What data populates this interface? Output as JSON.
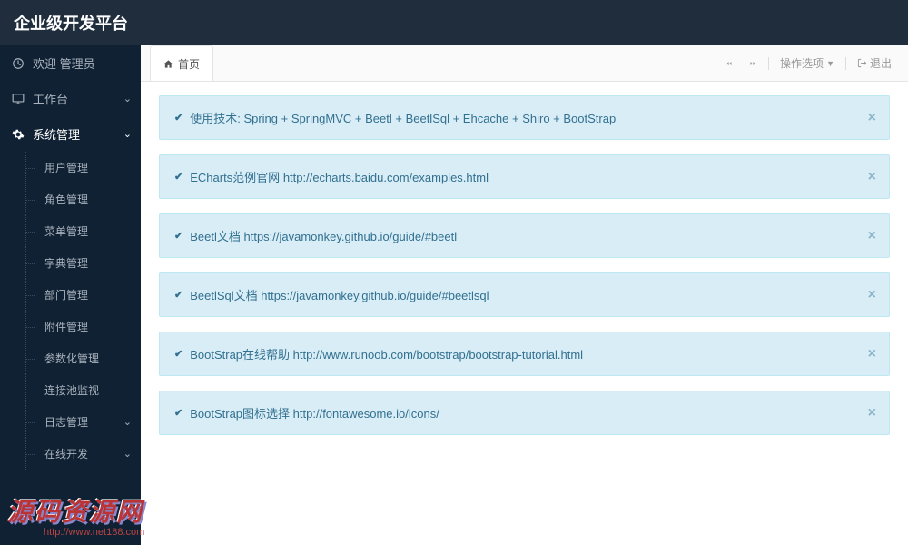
{
  "header": {
    "title": "企业级开发平台"
  },
  "sidebar": {
    "welcome_prefix": "欢迎",
    "welcome_user": "管理员",
    "workbench": "工作台",
    "system_mgmt": "系统管理",
    "sub": {
      "user_mgmt": "用户管理",
      "role_mgmt": "角色管理",
      "menu_mgmt": "菜单管理",
      "dict_mgmt": "字典管理",
      "dept_mgmt": "部门管理",
      "attach_mgmt": "附件管理",
      "param_mgmt": "参数化管理",
      "conn_monitor": "连接池监视",
      "log_mgmt": "日志管理",
      "online_dev": "在线开发"
    }
  },
  "tabs": {
    "home": "首页"
  },
  "tabbar": {
    "actions": "操作选项",
    "exit": "退出"
  },
  "alerts": [
    {
      "prefix": "使用技术:",
      "text": "Spring + SpringMVC + Beetl + BeetlSql + Ehcache + Shiro + BootStrap",
      "link": ""
    },
    {
      "prefix": "ECharts范例官网",
      "text": "",
      "link": "http://echarts.baidu.com/examples.html"
    },
    {
      "prefix": "Beetl文档",
      "text": "",
      "link": "https://javamonkey.github.io/guide/#beetl"
    },
    {
      "prefix": "BeetlSql文档",
      "text": "",
      "link": "https://javamonkey.github.io/guide/#beetlsql"
    },
    {
      "prefix": "BootStrap在线帮助",
      "text": "",
      "link": "http://www.runoob.com/bootstrap/bootstrap-tutorial.html"
    },
    {
      "prefix": "BootStrap图标选择",
      "text": "",
      "link": "http://fontawesome.io/icons/"
    }
  ],
  "watermark": {
    "main": "源码资源网",
    "sub": "http://www.net188.com"
  }
}
